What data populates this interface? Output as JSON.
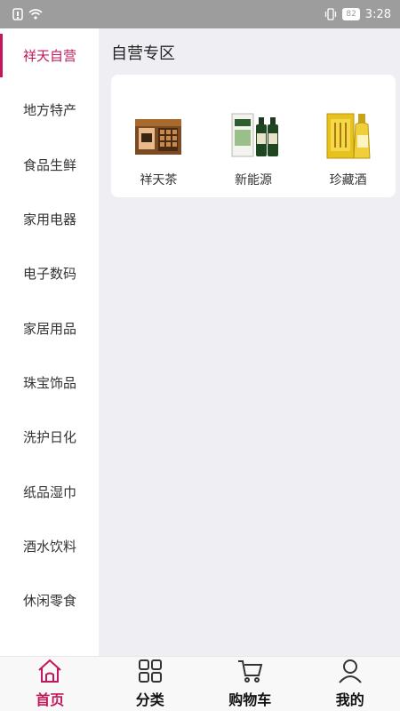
{
  "status": {
    "battery": "82",
    "time": "3:28"
  },
  "sidebar": {
    "items": [
      {
        "label": "祥天自营"
      },
      {
        "label": "地方特产"
      },
      {
        "label": "食品生鲜"
      },
      {
        "label": "家用电器"
      },
      {
        "label": "电子数码"
      },
      {
        "label": "家居用品"
      },
      {
        "label": "珠宝饰品"
      },
      {
        "label": "洗护日化"
      },
      {
        "label": "纸品湿巾"
      },
      {
        "label": "酒水饮料"
      },
      {
        "label": "休闲零食"
      }
    ],
    "active_index": 0
  },
  "main": {
    "title": "自营专区",
    "products": [
      {
        "name": "祥天茶",
        "icon": "tea-box-icon"
      },
      {
        "name": "新能源",
        "icon": "bottles-box-icon"
      },
      {
        "name": "珍藏酒",
        "icon": "liquor-box-icon"
      }
    ]
  },
  "nav": {
    "items": [
      {
        "label": "首页",
        "icon": "home-icon"
      },
      {
        "label": "分类",
        "icon": "grid-icon"
      },
      {
        "label": "购物车",
        "icon": "cart-icon"
      },
      {
        "label": "我的",
        "icon": "user-icon"
      }
    ],
    "active_index": 0
  },
  "colors": {
    "accent": "#c2185b",
    "status_bar": "#9d9d9d"
  }
}
